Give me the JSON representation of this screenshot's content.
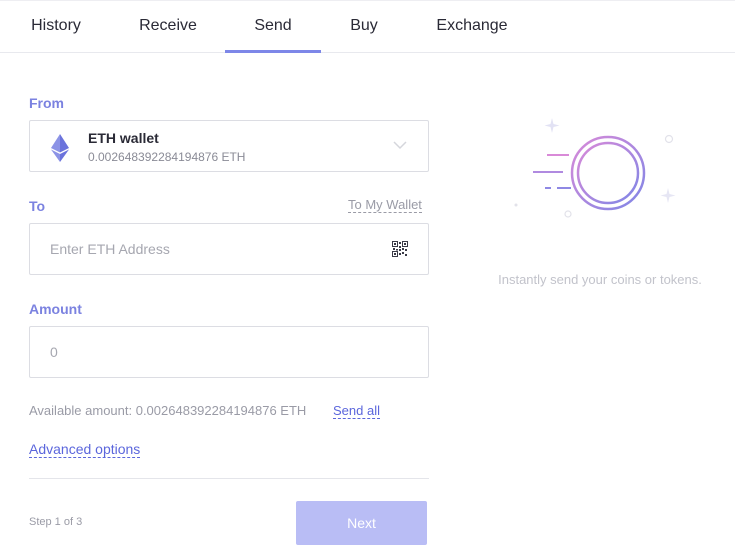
{
  "tabs": [
    {
      "label": "History"
    },
    {
      "label": "Receive"
    },
    {
      "label": "Send",
      "active": true
    },
    {
      "label": "Buy"
    },
    {
      "label": "Exchange"
    }
  ],
  "form": {
    "from_label": "From",
    "wallet_name": "ETH wallet",
    "wallet_balance": "0.002648392284194876 ETH",
    "to_label": "To",
    "to_my_wallet": "To My Wallet",
    "address_placeholder": "Enter ETH Address",
    "amount_label": "Amount",
    "amount_placeholder": "0",
    "available_amount": "Available amount: 0.002648392284194876 ETH",
    "send_all": "Send all",
    "advanced_options": "Advanced options",
    "step": "Step 1 of 3",
    "next": "Next"
  },
  "side": {
    "tagline": "Instantly send your coins or tokens."
  },
  "colors": {
    "accent": "#7b82e0",
    "link": "#5b66dc",
    "button_disabled": "#b9bdf5"
  },
  "icons": {
    "wallet": "ethereum-icon",
    "dropdown": "chevron-down-icon",
    "scan": "qr-code-icon",
    "illustration": "send-coin-illustration"
  }
}
